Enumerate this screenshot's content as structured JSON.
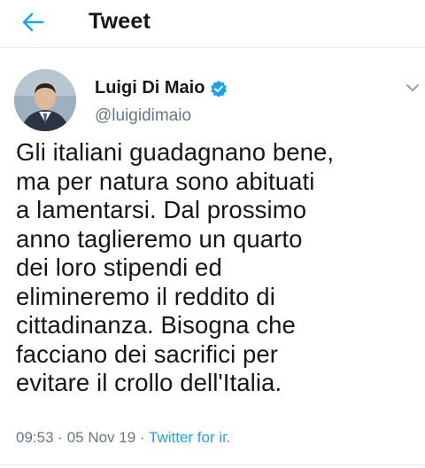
{
  "header": {
    "title": "Tweet",
    "back_icon": "arrow-left-icon"
  },
  "tweet": {
    "author": {
      "display_name": "Luigi Di Maio",
      "handle": "@luigidimaio",
      "verified_icon": "verified-badge-icon"
    },
    "text": "Gli italiani guadagnano bene,\nma per natura sono abituati\na lamentarsi. Dal prossimo\nanno taglieremo un quarto\ndei loro stipendi ed\nelimineremo il reddito di\ncittadinanza. Bisogna che\nfacciano dei sacrifici per\nevitare il crollo dell'Italia.",
    "time": "09:53",
    "separator": "·",
    "date": "05 Nov 19",
    "source": "Twitter for iг."
  },
  "colors": {
    "accent": "#1da1f2",
    "text": "#14171a",
    "muted": "#657786",
    "divider": "#e6ecf0"
  }
}
